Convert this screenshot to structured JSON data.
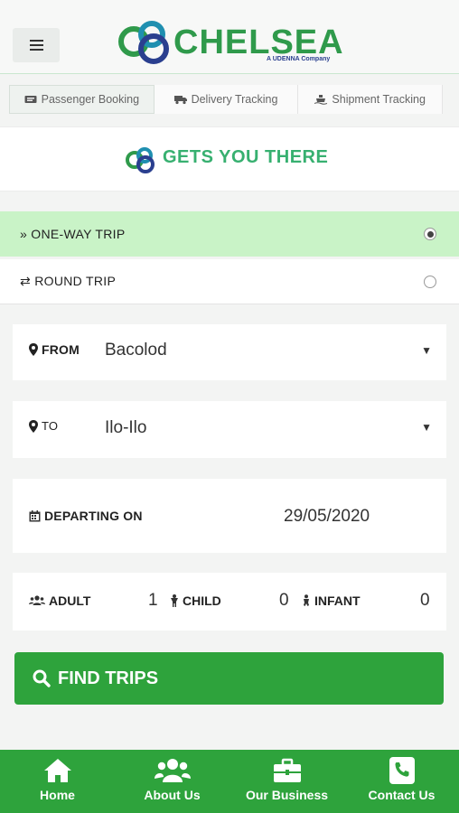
{
  "header": {
    "brand": "CHELSEA",
    "tagline": "A UDENNA Company",
    "colors": {
      "brand_green": "#2f9a4b",
      "brand_blue": "#2a3f8f"
    }
  },
  "tabs": [
    {
      "label": "Passenger Booking",
      "icon": "ticket-icon",
      "active": true
    },
    {
      "label": "Delivery Tracking",
      "icon": "truck-icon",
      "active": false
    },
    {
      "label": "Shipment Tracking",
      "icon": "ship-icon",
      "active": false
    }
  ],
  "tagline_band": {
    "text": "GETS YOU THERE"
  },
  "trip_type": {
    "one_way": {
      "label": "ONE-WAY TRIP",
      "selected": true
    },
    "round": {
      "label": "ROUND TRIP",
      "selected": false
    }
  },
  "route": {
    "from_label": "FROM",
    "from_value": "Bacolod",
    "to_label": "TO",
    "to_value": "Ilo-Ilo"
  },
  "departure": {
    "label": "DEPARTING ON",
    "value": "29/05/2020"
  },
  "passengers": {
    "adult_label": "ADULT",
    "adult_count": "1",
    "child_label": "CHILD",
    "child_count": "0",
    "infant_label": "INFANT",
    "infant_count": "0"
  },
  "find_button": {
    "label": "FIND TRIPS"
  },
  "bottom_nav": [
    {
      "label": "Home",
      "icon": "home-icon"
    },
    {
      "label": "About Us",
      "icon": "users-icon"
    },
    {
      "label": "Our Business",
      "icon": "briefcase-icon"
    },
    {
      "label": "Contact Us",
      "icon": "phone-icon"
    }
  ],
  "accent_color": "#2ea33c"
}
